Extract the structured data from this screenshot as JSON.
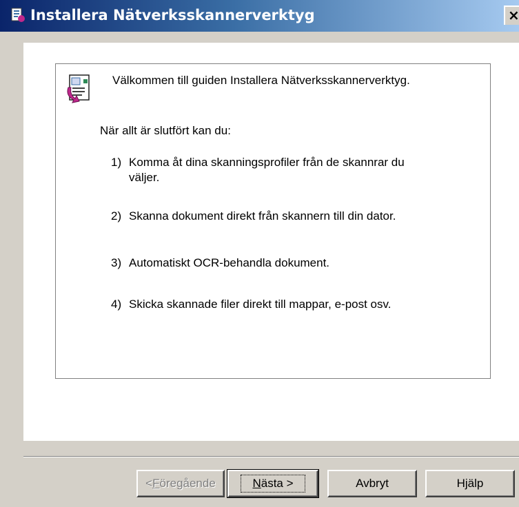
{
  "window": {
    "title": "Installera Nätverksskannerverktyg",
    "close_glyph": "×",
    "title_icon": "installer-icon"
  },
  "content": {
    "wizard_icon": "wizard-icon",
    "welcome": "Välkommen till guiden Installera Nätverksskannerverktyg.",
    "intro": "När allt är slutfört kan du:",
    "steps": [
      {
        "num": "1)",
        "text": "Komma åt dina skanningsprofiler från de skannrar du väljer."
      },
      {
        "num": "2)",
        "text": "Skanna dokument direkt från skannern till din dator."
      },
      {
        "num": "3)",
        "text": "Automatiskt OCR-behandla dokument."
      },
      {
        "num": "4)",
        "text": "Skicka skannade filer direkt till mappar, e-post osv."
      }
    ]
  },
  "buttons": {
    "back": {
      "prefix": "< ",
      "mnemonic": "F",
      "rest": "öregående"
    },
    "next": {
      "mnemonic": "N",
      "rest": "ästa >"
    },
    "cancel": "Avbryt",
    "help": "Hjälp"
  },
  "colors": {
    "titlebar_start": "#0a246a",
    "titlebar_end": "#a6caf0",
    "dialog_bg": "#d4d0c8",
    "content_bg": "#ffffff"
  }
}
